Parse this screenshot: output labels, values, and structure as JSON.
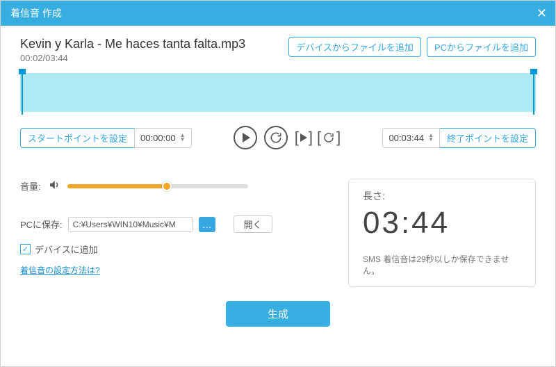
{
  "titlebar": {
    "title": "着信音 作成"
  },
  "file": {
    "name": "Kevin y Karla - Me haces tanta falta.mp3",
    "time": "00:02/03:44"
  },
  "buttons": {
    "add_from_device": "デバイスからファイルを追加",
    "add_from_pc": "PCからファイルを追加",
    "start_point": "スタートポイントを設定",
    "end_point": "終了ポイントを設定",
    "open": "開く",
    "generate": "生成",
    "browse": "…"
  },
  "times": {
    "start": "00:00:00",
    "end": "00:03:44"
  },
  "volume": {
    "label": "音量:",
    "percent": 55
  },
  "save": {
    "label": "PCに保存:",
    "path": "C:¥Users¥WIN10¥Music¥M"
  },
  "checkbox": {
    "label": "デバイスに追加",
    "checked": true
  },
  "help": {
    "text": "着信音の設定方法は?",
    "href": "#"
  },
  "length": {
    "label": "長さ:",
    "value": "03:44",
    "note": "SMS 着信音は29秒以しか保存できません。"
  }
}
